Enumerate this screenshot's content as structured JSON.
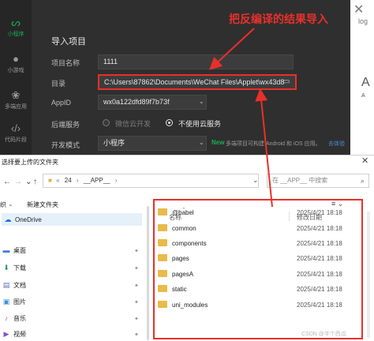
{
  "sidebar": {
    "items": [
      {
        "label": "小程序",
        "icon": "miniprogram-icon",
        "active": true
      },
      {
        "label": "小游戏",
        "icon": "minigame-icon",
        "active": false
      },
      {
        "label": "多端应用",
        "icon": "multiplatform-icon",
        "active": false
      },
      {
        "label": "代码片段",
        "icon": "code-snippet-icon",
        "active": false
      }
    ]
  },
  "right_strip": {
    "blog_text": "log",
    "big_letter": "A",
    "small_text": "A"
  },
  "import_dialog": {
    "title": "导入项目",
    "project_name_label": "项目名称",
    "project_name_value": "1111",
    "directory_label": "目录",
    "directory_value": "C:\\Users\\87862\\Documents\\WeChat Files\\Applet\\wx43d8",
    "appid_label": "AppID",
    "appid_value": "wx0a122dfd89f7b73f",
    "backend_label": "后端服务",
    "backend_option_cloud": "微信云开发",
    "backend_option_none": "不使用云服务",
    "backend_selected": "不使用云服务",
    "dev_mode_label": "开发模式",
    "dev_mode_value": "小程序",
    "new_badge": "New",
    "new_hint": "多端项目可构建 Android 和 iOS 应用。",
    "new_link": "去体验"
  },
  "annotation": {
    "text": "把反编译的结果导入",
    "color": "#e8302a"
  },
  "file_picker": {
    "title": "选择要上传的文件夹",
    "close_glyph": "✕",
    "address": {
      "crumbs": [
        "24",
        "__APP__"
      ]
    },
    "search_placeholder": "在 __APP__ 中搜索",
    "toolbar": {
      "new_folder": "新建文件夹",
      "organize": "织"
    },
    "nav_items": [
      {
        "label": "OneDrive",
        "icon": "cloud-icon",
        "pinned": false
      },
      {
        "label": "桌面",
        "icon": "desktop-icon",
        "pinned": true
      },
      {
        "label": "下载",
        "icon": "download-icon",
        "pinned": true
      },
      {
        "label": "文档",
        "icon": "document-icon",
        "pinned": true
      },
      {
        "label": "图片",
        "icon": "picture-icon",
        "pinned": true
      },
      {
        "label": "音乐",
        "icon": "music-icon",
        "pinned": true
      },
      {
        "label": "视频",
        "icon": "video-icon",
        "pinned": true
      }
    ],
    "columns": {
      "name": "名称",
      "modified": "修改日期"
    },
    "files": [
      {
        "name": "@babel",
        "date": "2025/4/21 18:18"
      },
      {
        "name": "common",
        "date": "2025/4/21 18:18"
      },
      {
        "name": "components",
        "date": "2025/4/21 18:18"
      },
      {
        "name": "pages",
        "date": "2025/4/21 18:18"
      },
      {
        "name": "pagesA",
        "date": "2025/4/21 18:18"
      },
      {
        "name": "static",
        "date": "2025/4/21 18:18"
      },
      {
        "name": "uni_modules",
        "date": "2025/4/21 18:18"
      }
    ]
  },
  "watermark": "CSDN @半个西瓜",
  "colors": {
    "accent_green": "#19ad55",
    "highlight_red": "#e8302a",
    "folder_yellow": "#e8bb4a",
    "dark_bg": "#2c2c2c"
  }
}
